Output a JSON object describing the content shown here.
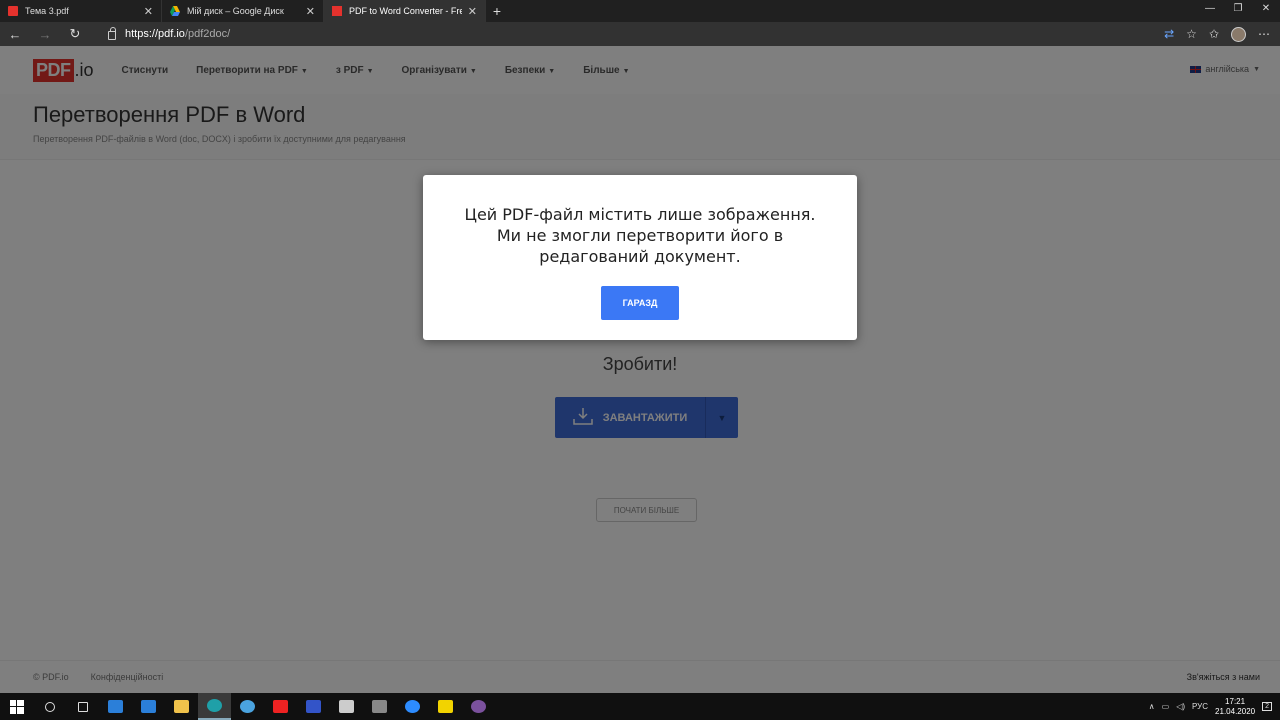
{
  "browser": {
    "tabs": [
      {
        "label": "Тема 3.pdf",
        "icon": "pdf-file-icon",
        "color": "#e5322d"
      },
      {
        "label": "Мій диск – Google Диск",
        "icon": "google-drive-icon",
        "color": "#f4b400"
      },
      {
        "label": "PDF to Word Converter - Free O",
        "icon": "pdfio-icon",
        "color": "#e5322d"
      }
    ],
    "url_host": "https://pdf.io",
    "url_path": "/pdf2doc/"
  },
  "site": {
    "logo_pdf": "PDF",
    "logo_io": ".io",
    "menu": [
      {
        "label": "Стиснути",
        "caret": false
      },
      {
        "label": "Перетворити на PDF",
        "caret": true
      },
      {
        "label": "з PDF",
        "caret": true
      },
      {
        "label": "Організувати",
        "caret": true
      },
      {
        "label": "Безпеки",
        "caret": true
      },
      {
        "label": "Більше",
        "caret": true
      }
    ],
    "language": "англійська",
    "title": "Перетворення PDF в Word",
    "subtitle": "Перетворення PDF-файлів в Word (doc, DOCX) і зробити їх доступними для редагування",
    "do_it": "Зробити!",
    "upload_label": "ЗАВАНТАЖИТИ",
    "start_over": "ПОЧАТИ БІЛЬШЕ",
    "footer": {
      "copyright": "© PDF.io",
      "privacy": "Конфіденційності",
      "contact": "Зв'яжіться з нами"
    }
  },
  "modal": {
    "message": "Цей PDF-файл містить лише зображення. Ми не змогли перетворити його в редагований документ.",
    "ok_label": "ГАРАЗД"
  },
  "taskbar": {
    "language": "РУС",
    "time": "17:21",
    "date": "21.04.2020",
    "notifications": "2",
    "apps": [
      {
        "name": "search-icon",
        "color": "#dddddd"
      },
      {
        "name": "task-view-icon",
        "color": "#dddddd"
      },
      {
        "name": "mail-icon",
        "color": "#2b7fd9"
      },
      {
        "name": "word-tiles-icon",
        "color": "#2b7fd9"
      },
      {
        "name": "file-explorer-icon",
        "color": "#f0c24b"
      },
      {
        "name": "edge-icon",
        "color": "#1fa0a8"
      },
      {
        "name": "mail-client-icon",
        "color": "#4aa3df"
      },
      {
        "name": "acrobat-icon",
        "color": "#e22"
      },
      {
        "name": "app-a-icon",
        "color": "#3354c8"
      },
      {
        "name": "inkscape-icon",
        "color": "#cccccc"
      },
      {
        "name": "spider-icon",
        "color": "#888888"
      },
      {
        "name": "zoom-icon",
        "color": "#2d8cff"
      },
      {
        "name": "sticky-notes-icon",
        "color": "#f2d300"
      },
      {
        "name": "viber-icon",
        "color": "#7b519d"
      }
    ]
  }
}
